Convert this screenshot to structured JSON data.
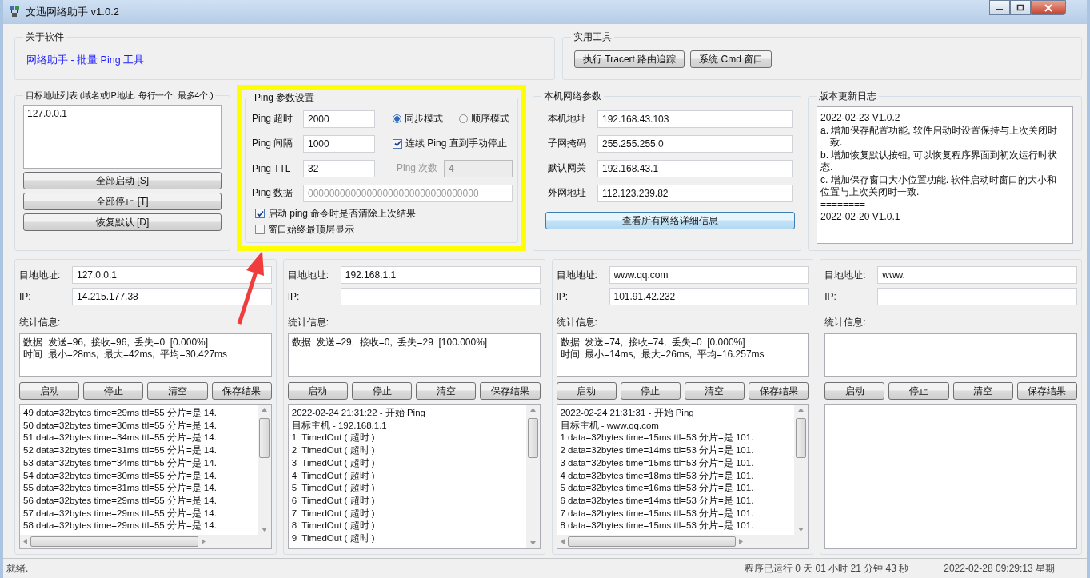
{
  "window": {
    "title": "文迅网络助手  v1.0.2"
  },
  "about": {
    "title": "关于软件",
    "link": "网络助手 - 批量 Ping 工具"
  },
  "tools": {
    "title": "实用工具",
    "buttons": [
      "执行 Tracert 路由追踪",
      "系统 Cmd 窗口"
    ]
  },
  "targets": {
    "title": "目标地址列表 (域名或IP地址. 每行一个, 最多4个.)",
    "value": "127.0.0.1",
    "buttons": [
      "全部启动 [S]",
      "全部停止 [T]",
      "恢复默认 [D]"
    ]
  },
  "ping": {
    "title": "Ping 参数设置",
    "timeout": {
      "label": "Ping 超时",
      "value": "2000"
    },
    "modes": [
      {
        "label": "同步模式",
        "selected": true
      },
      {
        "label": "顺序模式",
        "selected": false
      }
    ],
    "interval": {
      "label": "Ping 间隔",
      "value": "1000"
    },
    "continuous": {
      "label": "连续 Ping 直到手动停止",
      "checked": true
    },
    "ttl": {
      "label": "Ping TTL",
      "value": "32"
    },
    "count": {
      "label": "Ping 次数",
      "value": "4",
      "disabled": true
    },
    "data": {
      "label": "Ping 数据",
      "placeholder": "00000000000000000000000000000000"
    },
    "options": [
      {
        "label": "启动 ping 命令时是否清除上次结果",
        "checked": true
      },
      {
        "label": "窗口始终最顶层显示",
        "checked": false
      }
    ]
  },
  "network": {
    "title": "本机网络参数",
    "fields": [
      {
        "label": "本机地址",
        "value": "192.168.43.103"
      },
      {
        "label": "子网掩码",
        "value": "255.255.255.0"
      },
      {
        "label": "默认网关",
        "value": "192.168.43.1"
      },
      {
        "label": "外网地址",
        "value": "112.123.239.82"
      }
    ],
    "button": "查看所有网络详细信息"
  },
  "changelog": {
    "title": "版本更新日志",
    "lines": [
      "2022-02-23  V1.0.2",
      "a. 增加保存配置功能, 软件启动时设置保持与上次关闭时",
      "一致.",
      "b. 增加恢复默认按钮, 可以恢复程序界面到初次运行时状",
      "态.",
      "c. 增加保存窗口大小位置功能. 软件启动时窗口的大小和",
      "位置与上次关闭时一致.",
      "========",
      "2022-02-20  V1.0.1"
    ]
  },
  "panels": [
    {
      "address_label": "目地地址:",
      "address": "127.0.0.1",
      "ip_label": "IP:",
      "ip": "14.215.177.38",
      "stats_label": "统计信息:",
      "stats": [
        "数据  发送=96,  接收=96,  丢失=0  [0.000%]",
        "时间  最小=28ms,  最大=42ms,  平均=30.427ms"
      ],
      "buttons": [
        "启动",
        "停止",
        "清空",
        "保存结果"
      ],
      "horizontal_scrollbar": true,
      "log": [
        "49 data=32bytes time=29ms ttl=55 分片=是 14.",
        "50 data=32bytes time=30ms ttl=55 分片=是 14.",
        "51 data=32bytes time=34ms ttl=55 分片=是 14.",
        "52 data=32bytes time=31ms ttl=55 分片=是 14.",
        "53 data=32bytes time=34ms ttl=55 分片=是 14.",
        "54 data=32bytes time=30ms ttl=55 分片=是 14.",
        "55 data=32bytes time=31ms ttl=55 分片=是 14.",
        "56 data=32bytes time=29ms ttl=55 分片=是 14.",
        "57 data=32bytes time=29ms ttl=55 分片=是 14.",
        "58 data=32bytes time=29ms ttl=55 分片=是 14."
      ]
    },
    {
      "address_label": "目地地址:",
      "address": "192.168.1.1",
      "ip_label": "IP:",
      "stats_label": "统计信息:",
      "stats": [
        "数据  发送=29,  接收=0,  丢失=29  [100.000%]"
      ],
      "buttons": [
        "启动",
        "停止",
        "清空",
        "保存结果"
      ],
      "horizontal_scrollbar": false,
      "log": [
        "2022-02-24 21:31:22 - 开始 Ping",
        "目标主机 - 192.168.1.1",
        "1  TimedOut ( 超时 )",
        "2  TimedOut ( 超时 )",
        "3  TimedOut ( 超时 )",
        "4  TimedOut ( 超时 )",
        "5  TimedOut ( 超时 )",
        "6  TimedOut ( 超时 )",
        "7  TimedOut ( 超时 )",
        "8  TimedOut ( 超时 )",
        "9  TimedOut ( 超时 )"
      ]
    },
    {
      "address_label": "目地地址:",
      "address": "www.qq.com",
      "ip_label": "IP:",
      "ip": "101.91.42.232",
      "stats_label": "统计信息:",
      "stats": [
        "数据  发送=74,  接收=74,  丢失=0  [0.000%]",
        "时间  最小=14ms,  最大=26ms,  平均=16.257ms"
      ],
      "buttons": [
        "启动",
        "停止",
        "清空",
        "保存结果"
      ],
      "horizontal_scrollbar": true,
      "log": [
        "2022-02-24 21:31:31 - 开始 Ping",
        "目标主机 - www.qq.com",
        "1 data=32bytes time=15ms ttl=53 分片=是 101.",
        "2 data=32bytes time=14ms ttl=53 分片=是 101.",
        "3 data=32bytes time=15ms ttl=53 分片=是 101.",
        "4 data=32bytes time=18ms ttl=53 分片=是 101.",
        "5 data=32bytes time=16ms ttl=53 分片=是 101.",
        "6 data=32bytes time=14ms ttl=53 分片=是 101.",
        "7 data=32bytes time=15ms ttl=53 分片=是 101.",
        "8 data=32bytes time=15ms ttl=53 分片=是 101."
      ]
    },
    {
      "address_label": "目地地址:",
      "address": "www.",
      "ip_label": "IP:",
      "stats_label": "统计信息:",
      "buttons": [
        "启动",
        "停止",
        "清空",
        "保存结果"
      ],
      "horizontal_scrollbar": false
    }
  ],
  "status_bar": {
    "message": "就绪.",
    "uptime": "程序已运行 0 天 01 小时 21 分钟 43 秒",
    "datetime": "2022-02-28 09:29:13 星期一"
  }
}
